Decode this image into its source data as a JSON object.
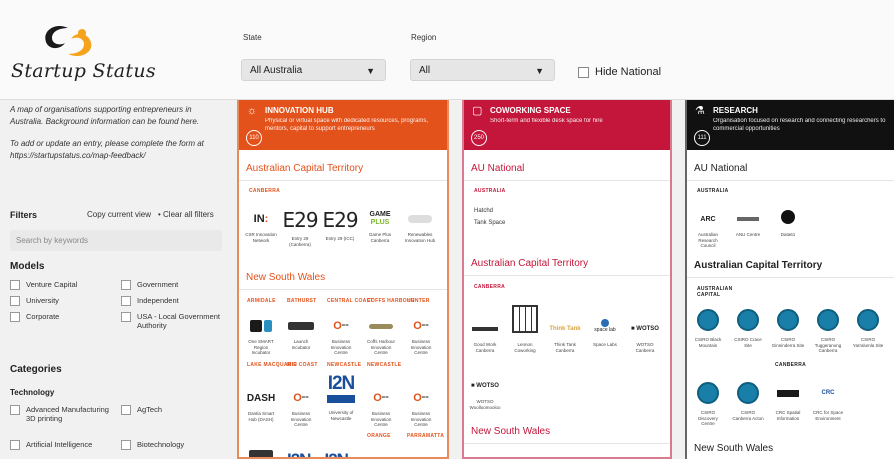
{
  "app": {
    "logo_text": "Startup Status"
  },
  "filters_bar": {
    "state_label": "State",
    "state_value": "All Australia",
    "region_label": "Region",
    "region_value": "All",
    "hide_national_label": "Hide National"
  },
  "sidebar": {
    "intro_1": "A map of organisations supporting entrepreneurs in Australia. Background information can be found here.",
    "intro_2": "To add or update an entry, please complete the form at https://startupstatus.co/map-feedback/",
    "filters_title": "Filters",
    "copy_view": "Copy current view",
    "clear_filters": "• Clear all filters",
    "search_placeholder": "Search by keywords",
    "models_title": "Models",
    "models": [
      "Venture Capital",
      "Government",
      "University",
      "Independent",
      "Corporate",
      "USA - Local Government Authority"
    ],
    "categories_title": "Categories",
    "technology_title": "Technology",
    "technology": [
      "Advanced Manufacturing 3D printing",
      "AgTech",
      "Artificial Intelligence",
      "Biotechnology"
    ]
  },
  "columns": [
    {
      "title": "INNOVATION HUB",
      "desc": "Physical or virtual space with dedicated resources, programs, mentors, capital to support entrepreneurs",
      "count": "110",
      "color": "#e4521b",
      "border": "#e88a5a",
      "icon": "lightbulb-icon",
      "region1": "Australian Capital Territory",
      "sub1": "CANBERRA",
      "tiles1": [
        {
          "logo": "IN",
          "label": "CSR Innovation Network"
        },
        {
          "logo": "E29",
          "label": "Entry 29 (Canberra)"
        },
        {
          "logo": "E29",
          "label": "Entry 29 (ICC)"
        },
        {
          "logo": "GAME",
          "label": "Game Plus Canberra"
        },
        {
          "logo": "",
          "label": "Renewables Innovation Hub"
        }
      ],
      "region2": "New South Wales",
      "subs2": [
        "ARMIDALE",
        "BATHURST",
        "CENTRAL COAST",
        "COFFS HARBOUR",
        "HUNTER"
      ],
      "tiles2": [
        {
          "logo": "",
          "label": "One SMART Region Incubator"
        },
        {
          "logo": "",
          "label": "Launch Incubator"
        },
        {
          "logo": "",
          "label": "Business Innovation Centre"
        },
        {
          "logo": "",
          "label": "Coffs Harbour Innovation Centre"
        },
        {
          "logo": "",
          "label": "Business Innovation Centre"
        }
      ],
      "subs3": [
        "LAKE MACQUARIE",
        "MID COAST",
        "NEWCASTLE",
        "NEWCASTLE"
      ],
      "tiles3": [
        {
          "logo": "DASH",
          "label": "Dantia Smart Hub (DASH)"
        },
        {
          "logo": "",
          "label": "Business Innovation Centre"
        },
        {
          "logo": "I2N",
          "label": "University of Newcastle"
        },
        {
          "logo": "",
          "label": "Business Innovation Centre"
        },
        {
          "logo": "",
          "label": "Business Innovation Centre"
        }
      ],
      "subs4": [
        "ORANGE",
        "PARRAMATTA"
      ]
    },
    {
      "title": "COWORKING SPACE",
      "desc": "Short-term and flexible desk space for hire",
      "count": "250",
      "color": "#c4163a",
      "border": "#d97a8e",
      "icon": "coworking-icon",
      "region1": "AU National",
      "sub1": "AUSTRALIA",
      "tiles1": [
        {
          "logo": "",
          "label": "Hatchd"
        },
        {
          "logo": "",
          "label": "Tank Space"
        }
      ],
      "region2": "Australian Capital Territory",
      "subs2": [
        "CANBERRA"
      ],
      "tiles2": [
        {
          "logo": "",
          "label": "Good Work Canberra"
        },
        {
          "logo": "",
          "label": "Lennon Coworking"
        },
        {
          "logo": "",
          "label": "Think Tank Canberra"
        },
        {
          "logo": "",
          "label": "Space Labs"
        },
        {
          "logo": "",
          "label": "WOTSO Canberra"
        }
      ],
      "tiles3": [
        {
          "logo": "",
          "label": "WOTSO Woolloomooloo"
        }
      ],
      "region3": "New South Wales"
    },
    {
      "title": "RESEARCH",
      "desc": "Organisation focused on research and connecting researchers to commercial opportunities",
      "count": "111",
      "color": "#111111",
      "border": "#666666",
      "icon": "flask-icon",
      "region1": "AU National",
      "sub1": "AUSTRALIA",
      "tiles1": [
        {
          "logo": "",
          "label": "Australian Research Council"
        },
        {
          "logo": "",
          "label": "ANU Centre"
        },
        {
          "logo": "",
          "label": "Data61"
        }
      ],
      "region2": "Australian Capital Territory",
      "subs2": [
        "AUSTRALIAN CAPITAL"
      ],
      "tiles2": [
        {
          "logo": "",
          "label": "CSIRO Black Mountain"
        },
        {
          "logo": "",
          "label": "CSIRO Crace Site"
        },
        {
          "logo": "",
          "label": "CSIRO Ginninderra Site"
        },
        {
          "logo": "",
          "label": "CSIRO Tuggeranong Canberra"
        },
        {
          "logo": "",
          "label": "CSIRO Yarralumla Site"
        }
      ],
      "subs3": [
        "CANBERRA"
      ],
      "tiles3": [
        {
          "logo": "",
          "label": "CSIRO Discovery Centre"
        },
        {
          "logo": "",
          "label": "CSIRO Canberra Acton"
        },
        {
          "logo": "",
          "label": "CRC Spatial Information"
        },
        {
          "logo": "",
          "label": "CRC for Space Environment"
        }
      ],
      "region3": "New South Wales"
    }
  ]
}
